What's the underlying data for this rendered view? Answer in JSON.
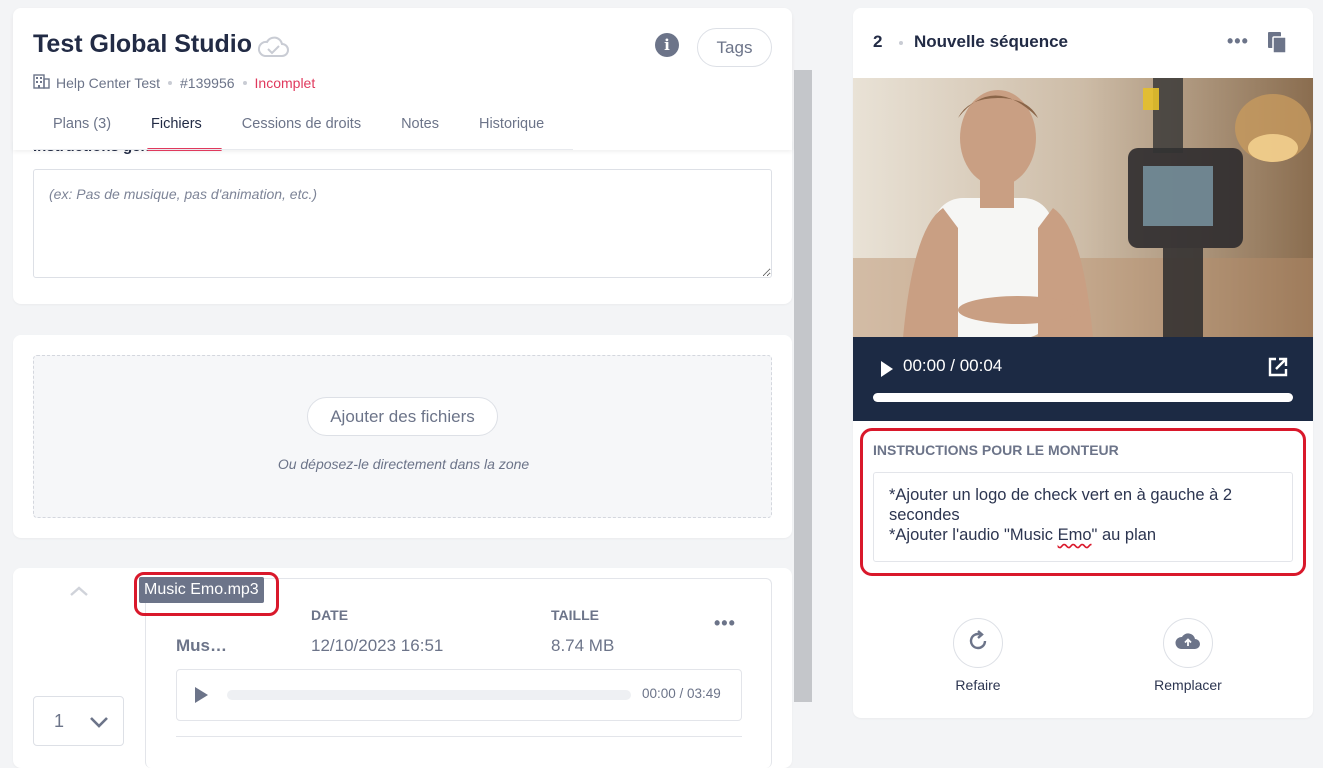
{
  "project": {
    "title": "Test Global Studio",
    "workspace": "Help Center Test",
    "id": "#139956",
    "status": "Incomplet",
    "tags_label": "Tags",
    "info_icon": "info-icon",
    "cloud_icon": "cloud-check-icon"
  },
  "tabs": [
    {
      "label": "Plans (3)",
      "active": false
    },
    {
      "label": "Fichiers",
      "active": true
    },
    {
      "label": "Cessions de droits",
      "active": false
    },
    {
      "label": "Notes",
      "active": false
    },
    {
      "label": "Historique",
      "active": false
    }
  ],
  "instructions": {
    "label": "Instructions générales",
    "placeholder": "(ex: Pas de musique, pas d'animation, etc.)"
  },
  "upload": {
    "button_label": "Ajouter des fichiers",
    "hint": "Ou déposez-le directement dans la zone"
  },
  "file": {
    "tooltip": "Music Emo.mp3",
    "name_short": "Mus…",
    "date_header": "DATE",
    "date_value": "12/10/2023 16:51",
    "size_header": "TAILLE",
    "size_value": "8.74 MB",
    "audio_time": "00:00 / 03:49",
    "order_value": "1"
  },
  "sequence": {
    "number": "2",
    "title": "Nouvelle séquence",
    "video_time": "00:00 / 00:04",
    "editor_label": "INSTRUCTIONS POUR LE MONTEUR",
    "editor_line1": "*Ajouter un logo de check vert en à gauche à 2 secondes",
    "editor_line2_a": "*Ajouter l'audio \"Music ",
    "editor_line2_b": "Emo",
    "editor_line2_c": "\" au plan",
    "redo_label": "Refaire",
    "replace_label": "Remplacer"
  },
  "colors": {
    "accent": "#e0395d",
    "highlight": "#d9182b",
    "video_bar": "#1c2a44",
    "text_dark": "#222b45",
    "text_muted": "#6c7489"
  }
}
